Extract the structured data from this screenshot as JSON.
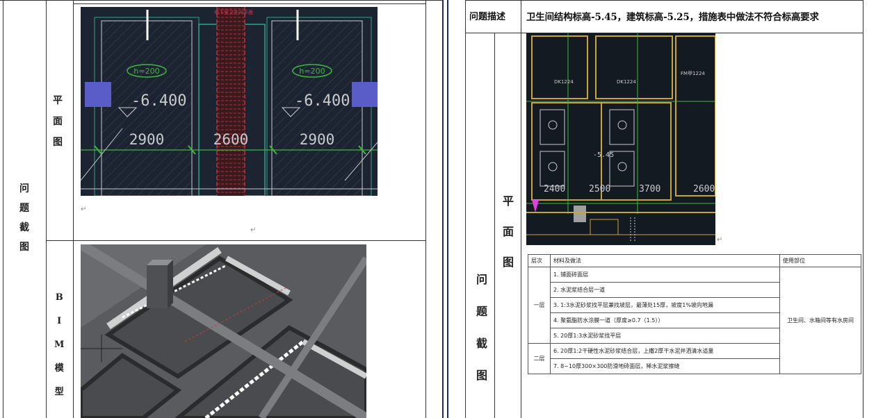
{
  "left": {
    "section_label": [
      "问",
      "题",
      "截",
      "图"
    ],
    "plan_label": [
      "平",
      "面",
      "图"
    ],
    "bim_label": [
      "B",
      "I",
      "M",
      "模",
      "型"
    ],
    "plan_title": "地下室卫生间平面",
    "elev_tag": "h=200",
    "levels": [
      "-6.400",
      "-6.400"
    ],
    "dims": [
      "2900",
      "2600",
      "2900"
    ]
  },
  "right": {
    "desc_label": "问题描述",
    "desc_text": "卫生间结构标高-5.45，建筑标高-5.25，措施表中做法不符合标高要求",
    "section_label": [
      "问",
      "题",
      "截",
      "图"
    ],
    "plan_label": [
      "平",
      "面",
      "图"
    ],
    "plan_dims": [
      "2400",
      "2500",
      "3700",
      "2600"
    ],
    "plan_codes": [
      "DK1224",
      "DK1224",
      "FM甲1224"
    ],
    "plan_level": "-5.45",
    "legend": {
      "headers": [
        "层次",
        "材料及做法",
        "使用部位"
      ],
      "group1_label": "一层",
      "group2_label": "二层",
      "usage": "卫生间、水箱间等有水房间",
      "rows": [
        "1. 铺面砖面层",
        "2. 水泥浆结合层一道",
        "3. 1:3水泥砂浆找平层兼找坡层，最薄处15厚，坡度1%坡向地漏",
        "4. 聚氨酯防水涂膜一道（厚度≥0.7（1.5））",
        "5. 20厚1:3水泥砂浆找平层",
        "6. 20厚1:2干硬性水泥砂浆结合层，上撒2厚干水泥并洒清水适量",
        "7. 8~10厚300×300防滑地砖面层，稀水泥浆擦缝"
      ]
    }
  }
}
